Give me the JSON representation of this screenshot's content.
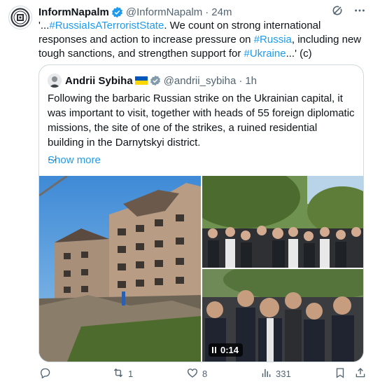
{
  "tweet": {
    "author_name": "InformNapalm",
    "handle": "@InformNapalm",
    "separator": "·",
    "time": "24m",
    "text_prefix": "'...",
    "hashtag1": "#RussiaIsATerroristState",
    "text_mid1": ". We count on strong international responses and action to increase pressure on ",
    "hashtag2": "#Russia",
    "text_mid2": ", including new tough sanctions, and strengthen support for ",
    "hashtag3": "#Ukraine",
    "text_suffix": "...' (c)"
  },
  "quote": {
    "author_name": "Andrii Sybiha",
    "handle": "@andrii_sybiha",
    "separator": "·",
    "time": "1h",
    "text": "Following the barbaric Russian strike on the Ukrainian capital, it was important to visit, together with heads of 55 foreign diplomatic missions, the site of one of the strikes, a ruined residential building in the Darnytskyi district.",
    "ellipsis": "...",
    "show_more": "Show more",
    "video_duration": "0:14"
  },
  "actions": {
    "reply_count": "",
    "repost_count": "1",
    "like_count": "8",
    "views_count": "331"
  },
  "colors": {
    "accent": "#1d9bf0",
    "muted": "#536471",
    "verified": "#1d9bf0",
    "flag_blue": "#0057b7",
    "flag_yellow": "#ffd700"
  },
  "icons": [
    "grok-icon",
    "more-icon",
    "verified-icon",
    "reply-icon",
    "repost-icon",
    "like-icon",
    "views-icon",
    "bookmark-icon",
    "share-icon",
    "pause-icon"
  ]
}
